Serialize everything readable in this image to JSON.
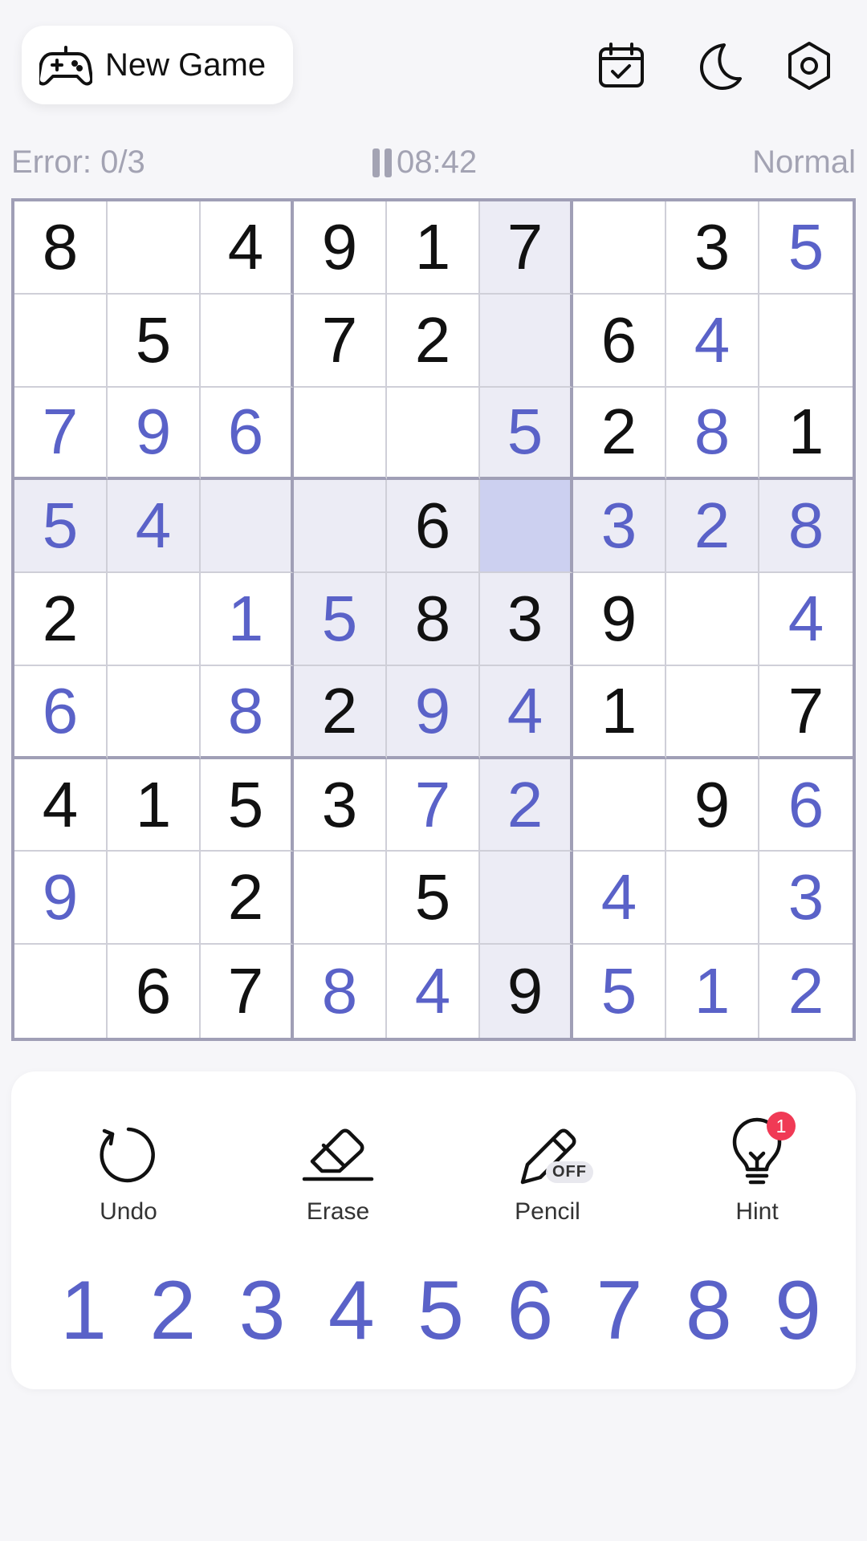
{
  "header": {
    "new_game_label": "New Game"
  },
  "status": {
    "errors": "Error: 0/3",
    "timer": "08:42",
    "difficulty": "Normal"
  },
  "board": {
    "givens": [
      "8.4917.3.",
      ".5.72.6..",
      "......2.1",
      "....6....",
      "2...839..",
      "...2..1.7",
      "4153...9.",
      "..2.5....",
      ".67..9..."
    ],
    "entries": [
      "........5",
      ".......4.",
      "796..5.8.",
      "54....328",
      "..15....4",
      "6.8.94...",
      "....72..6",
      "9.....4.3",
      "...84.512"
    ],
    "selected": {
      "row": 3,
      "col": 5
    }
  },
  "tools": [
    {
      "label": "Undo",
      "icon": "undo-icon"
    },
    {
      "label": "Erase",
      "icon": "eraser-icon"
    },
    {
      "label": "Pencil",
      "icon": "pencil-icon",
      "state": "OFF"
    },
    {
      "label": "Hint",
      "icon": "lightbulb-icon",
      "count": "1"
    }
  ],
  "numpad": [
    "1",
    "2",
    "3",
    "4",
    "5",
    "6",
    "7",
    "8",
    "9"
  ],
  "colors": {
    "accent": "#5a62c8",
    "given": "#111111",
    "highlight": "#ececf5",
    "selected": "#ccd0f0",
    "badge": "#f03a55"
  }
}
